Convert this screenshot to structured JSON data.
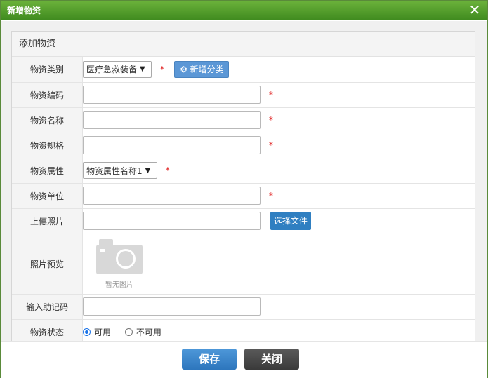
{
  "dialog": {
    "title": "新增物资"
  },
  "panel": {
    "header": "添加物资"
  },
  "rows": {
    "category": {
      "label": "物资类别",
      "selected": "医疗急救装备",
      "add_button": "新增分类"
    },
    "code": {
      "label": "物资编码",
      "value": ""
    },
    "name": {
      "label": "物资名称",
      "value": ""
    },
    "spec": {
      "label": "物资规格",
      "value": ""
    },
    "attribute": {
      "label": "物资属性",
      "selected": "物资属性名称1"
    },
    "unit": {
      "label": "物资单位",
      "value": ""
    },
    "upload": {
      "label": "上僡照片",
      "value": "",
      "button": "选择文件"
    },
    "preview": {
      "label": "照片预览",
      "caption": "暂无图片"
    },
    "mnemonic": {
      "label": "输入助记码",
      "value": ""
    },
    "status": {
      "label": "物资状态",
      "options": [
        "可用",
        "不可用"
      ],
      "selected": "可用"
    }
  },
  "required_mark": "*",
  "footer": {
    "save": "保存",
    "close": "关闭"
  },
  "colors": {
    "title_bar": "#4f9a2a",
    "primary_button": "#2d76bd",
    "dark_button": "#3a3a3a",
    "required": "#e02020"
  }
}
